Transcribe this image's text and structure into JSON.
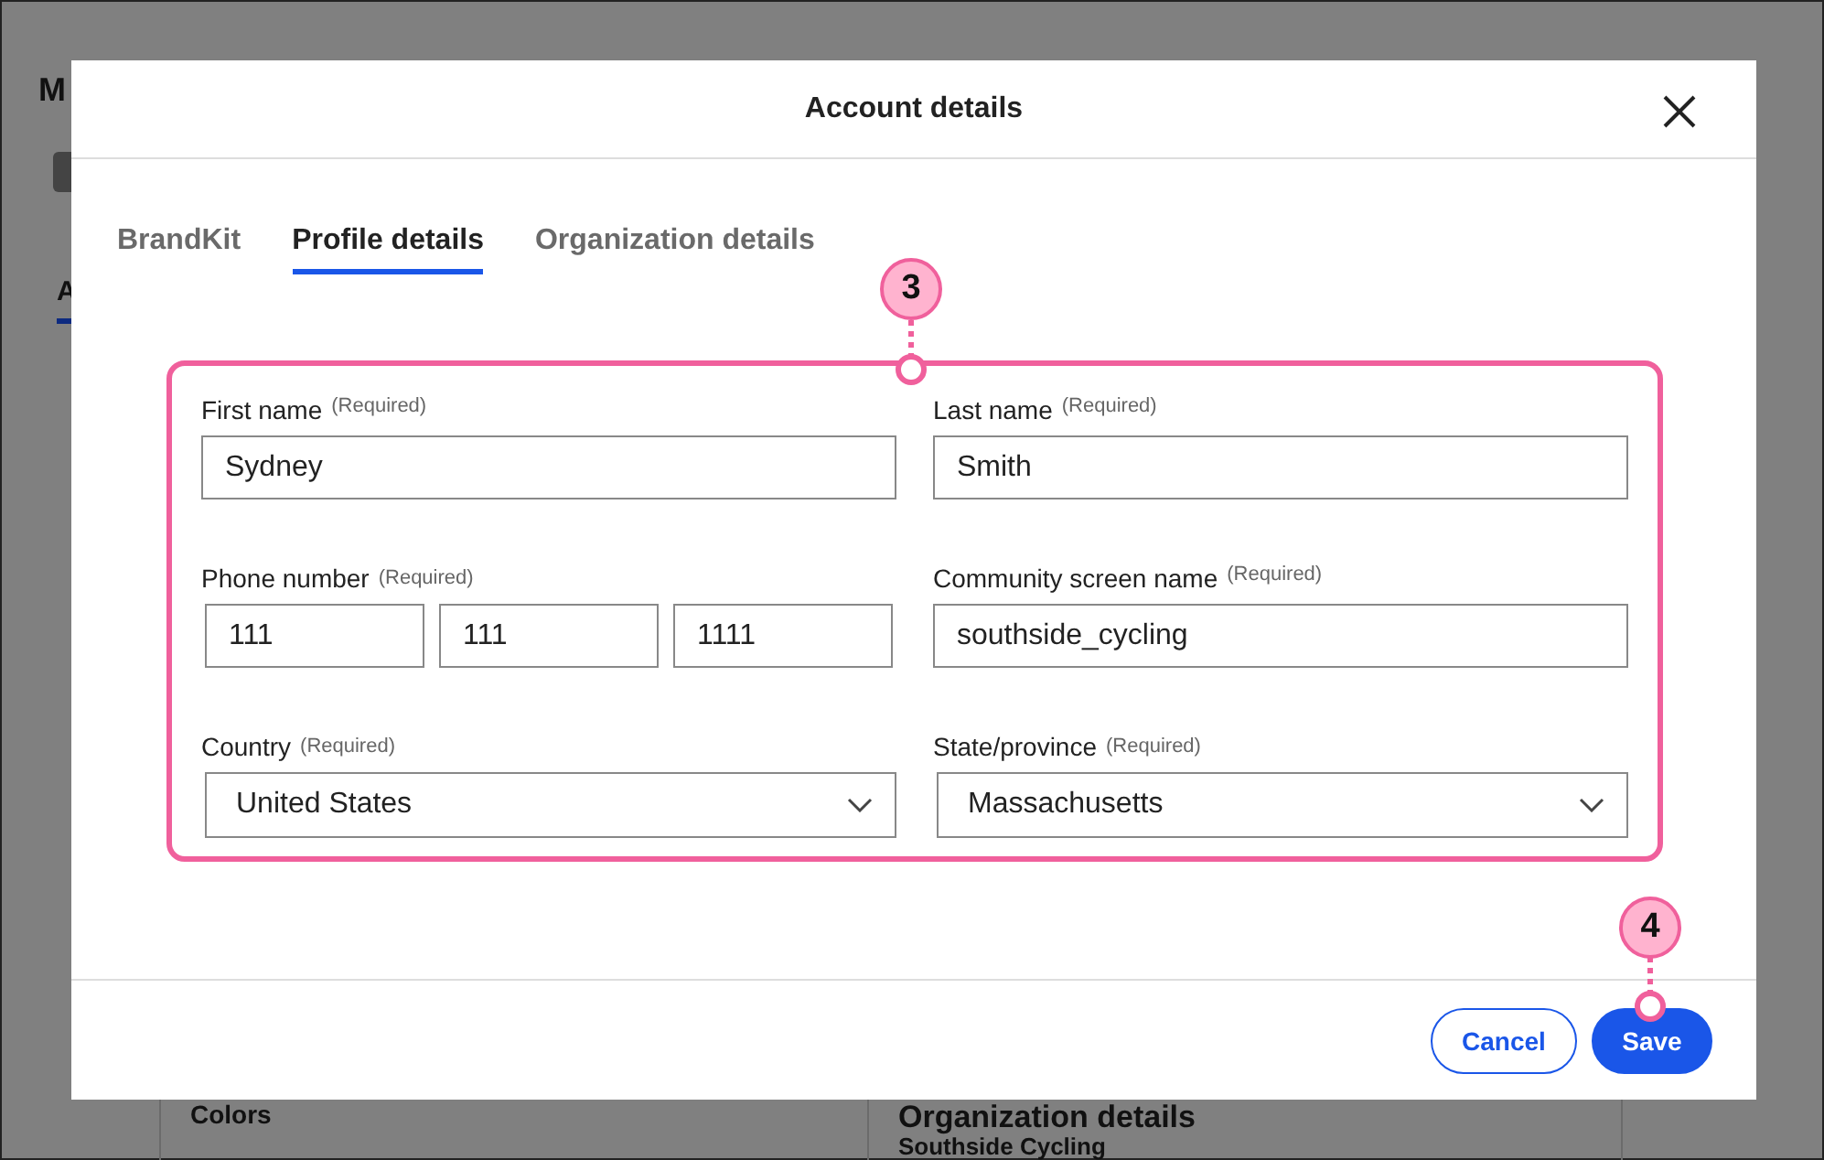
{
  "background_page": {
    "heading": "M",
    "tab": "A",
    "panels": [
      {
        "title": "Colors"
      },
      {
        "title": "Organization details",
        "subtitle": "Southside Cycling"
      }
    ]
  },
  "dialog": {
    "title": "Account details",
    "tabs": [
      {
        "label": "BrandKit",
        "selected": false
      },
      {
        "label": "Profile details",
        "selected": true
      },
      {
        "label": "Organization details",
        "selected": false
      }
    ],
    "fields": [
      {
        "kind": "text",
        "label": "First name",
        "note": "(Required)",
        "value": "Sydney"
      },
      {
        "kind": "text",
        "label": "Last name",
        "note": "(Required)",
        "value": "Smith"
      },
      {
        "kind": "phone",
        "label": "Phone number",
        "note": "(Required)",
        "values": [
          "111",
          "111",
          "1111"
        ]
      },
      {
        "kind": "text",
        "label": "Community screen name",
        "note": "(Required)",
        "value": "southside_cycling"
      },
      {
        "kind": "select",
        "label": "Country",
        "note": "(Required)",
        "value": "United States"
      },
      {
        "kind": "select",
        "label": "State/province",
        "note": "(Required)",
        "value": "Massachusetts"
      }
    ],
    "buttons": [
      {
        "label": "Cancel",
        "kind": "secondary"
      },
      {
        "label": "Save",
        "kind": "primary"
      }
    ]
  },
  "annotations": [
    {
      "number": "3"
    },
    {
      "number": "4"
    }
  ]
}
